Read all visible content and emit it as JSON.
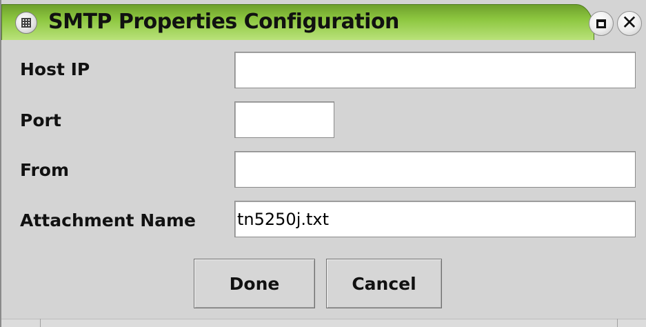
{
  "window": {
    "title": "SMTP Properties Configuration",
    "title_bar_color": "#8cc63f"
  },
  "form": {
    "host_ip": {
      "label": "Host IP",
      "value": ""
    },
    "port": {
      "label": "Port",
      "value": ""
    },
    "from": {
      "label": "From",
      "value": ""
    },
    "attachment_name": {
      "label": "Attachment Name",
      "value": "tn5250j.txt"
    }
  },
  "buttons": {
    "done_label": "Done",
    "cancel_label": "Cancel"
  }
}
